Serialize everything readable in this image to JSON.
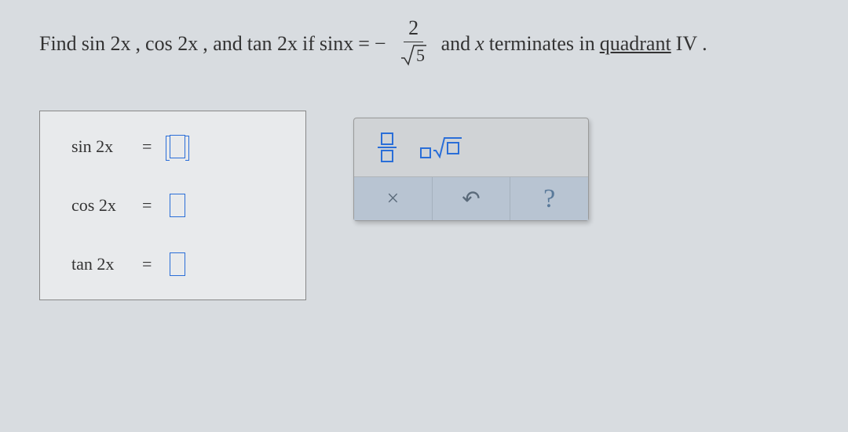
{
  "question": {
    "prefix": "Find",
    "expr1": "sin 2x",
    "comma1": ",",
    "expr2": "cos 2x",
    "comma2": ", and",
    "expr3": "tan 2x",
    "if": "if",
    "given_lhs": "sinx",
    "equals": "=",
    "neg": "−",
    "numerator": "2",
    "denom_symbol": "√",
    "denom_value": "5",
    "and": "and",
    "x": "x",
    "terminates": "terminates in",
    "quadrant_word": "quadrant",
    "quadrant_num": "IV",
    "period": "."
  },
  "answers": {
    "rows": [
      {
        "label": "sin 2x",
        "active": true
      },
      {
        "label": "cos 2x",
        "active": false
      },
      {
        "label": "tan 2x",
        "active": false
      }
    ],
    "equals": "="
  },
  "toolbox": {
    "clear": "×",
    "undo": "↶",
    "help": "?"
  }
}
